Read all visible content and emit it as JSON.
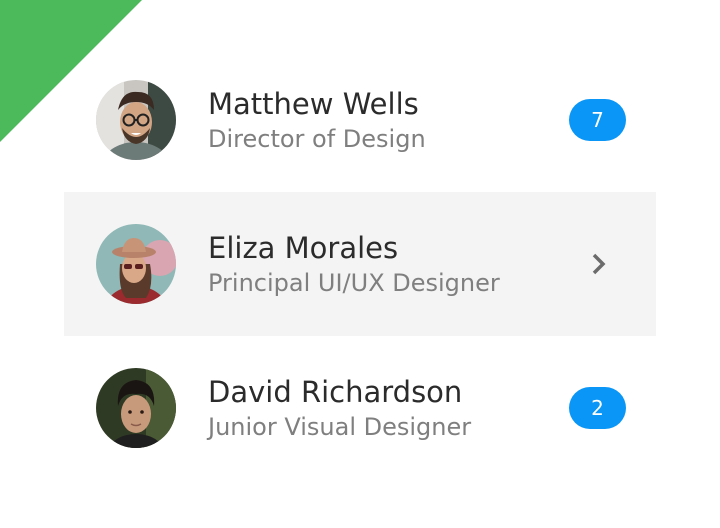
{
  "colors": {
    "accent": "#4cb95a",
    "badge": "#0a96f6",
    "selected_row": "#f4f4f4"
  },
  "contacts": [
    {
      "name": "Matthew Wells",
      "title": "Director of Design",
      "badge": "7",
      "avatar": "avatar-man-glasses"
    },
    {
      "name": "Eliza Morales",
      "title": "Principal UI/UX Designer",
      "action_icon": "chevron-right-icon",
      "avatar": "avatar-woman-hat"
    },
    {
      "name": "David Richardson",
      "title": "Junior Visual Designer",
      "badge": "2",
      "avatar": "avatar-young-man"
    }
  ]
}
